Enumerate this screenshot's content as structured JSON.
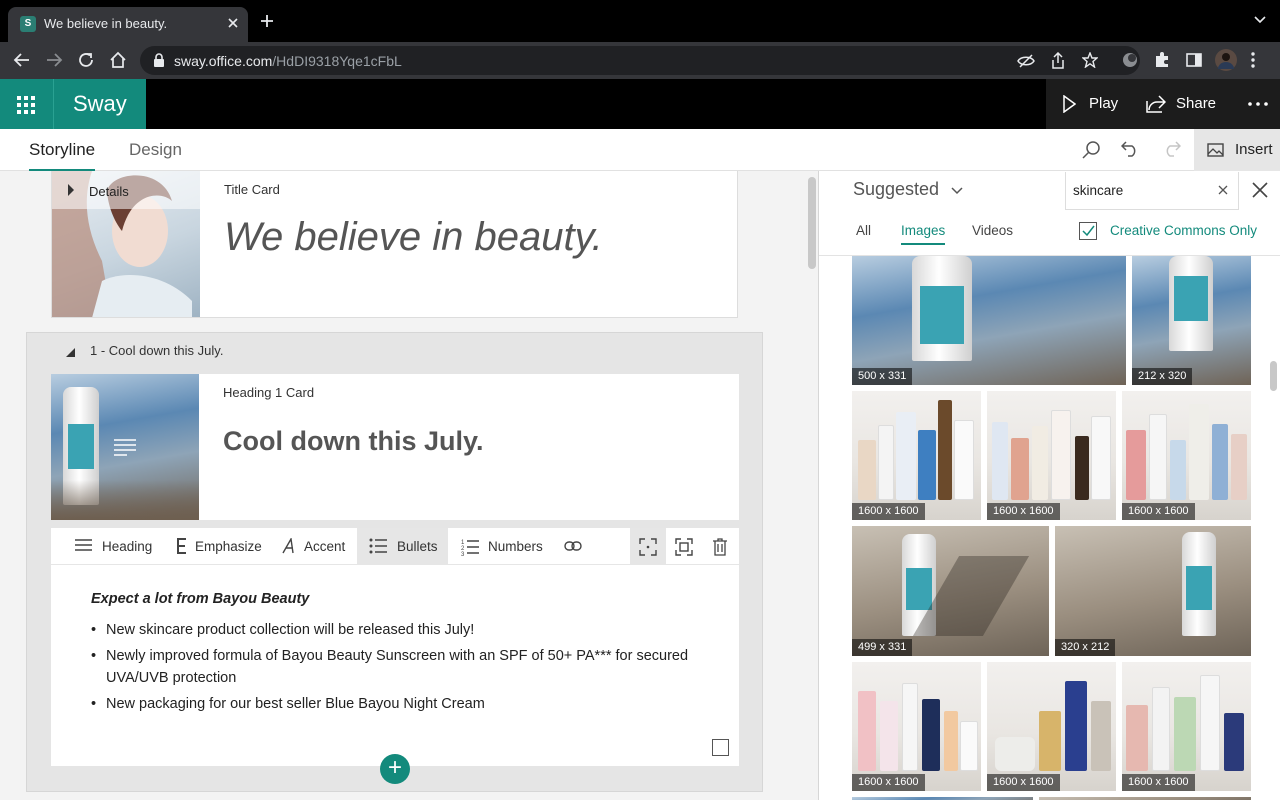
{
  "browser": {
    "tab_title": "We believe in beauty.",
    "favicon_text": "S",
    "url_host": "sway.office.com",
    "url_path": "/HdDI9318Yqe1cFbL"
  },
  "app": {
    "brand": "Sway",
    "play_label": "Play",
    "share_label": "Share",
    "brand_color": "#138a7c"
  },
  "toolbar": {
    "storyline": "Storyline",
    "design": "Design",
    "insert": "Insert"
  },
  "storyline": {
    "title_card": {
      "details_label": "Details",
      "type": "Title Card",
      "text": "We believe in beauty."
    },
    "section": {
      "title": "1 - Cool down this July.",
      "heading_card": {
        "type": "Heading 1 Card",
        "text": "Cool down this July."
      },
      "text_card": {
        "format": {
          "heading": "Heading",
          "emphasize": "Emphasize",
          "accent": "Accent",
          "bullets": "Bullets",
          "numbers": "Numbers"
        },
        "heading": "Expect a lot from Bayou Beauty",
        "bullets": [
          "New skincare product collection will be released this July!",
          "Newly improved formula of Bayou Beauty Sunscreen with an SPF of 50+ PA*** for secured UVA/UVB protection",
          "New packaging for our best seller Blue Bayou Night Cream"
        ]
      },
      "add_label": "+"
    }
  },
  "panel": {
    "suggested": "Suggested",
    "search_value": "skincare",
    "filters": [
      "All",
      "Images",
      "Videos"
    ],
    "creative_commons": "Creative Commons Only",
    "images": [
      {
        "dims": "500 x 331",
        "kind": "sea"
      },
      {
        "dims": "212 x 320",
        "kind": "sea"
      },
      {
        "dims": "1600 x 1600",
        "kind": "shelf"
      },
      {
        "dims": "1600 x 1600",
        "kind": "shelf"
      },
      {
        "dims": "1600 x 1600",
        "kind": "shelf"
      },
      {
        "dims": "499 x 331",
        "kind": "sand"
      },
      {
        "dims": "320 x 212",
        "kind": "sand"
      },
      {
        "dims": "1600 x 1600",
        "kind": "shelf"
      },
      {
        "dims": "1600 x 1600",
        "kind": "shelf"
      },
      {
        "dims": "1600 x 1600",
        "kind": "shelf"
      }
    ]
  }
}
